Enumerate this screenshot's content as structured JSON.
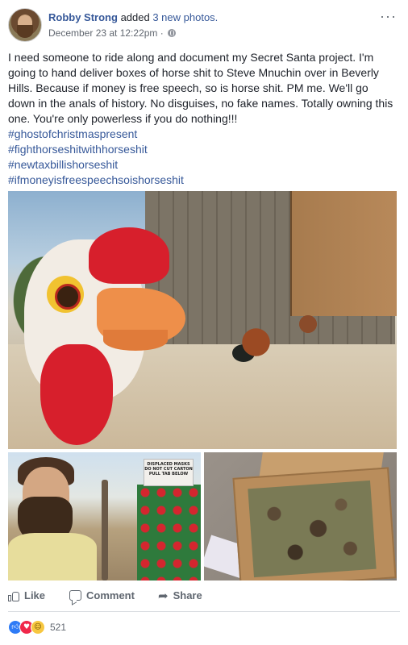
{
  "post": {
    "author": "Robby Strong",
    "action_prefix": "added",
    "action_link": "3 new photos.",
    "timestamp": "December 23 at 12:22pm",
    "separator": "·",
    "audience_icon": "globe-icon",
    "more_icon": "···",
    "body": "I need someone to ride along and document my Secret Santa project. I'm going to hand deliver boxes of horse shit to Steve Mnuchin over in Beverly Hills. Because if money is free speech, so is horse shit. PM me. We'll go down in the anals of history. No disguises, no fake names. Totally owning this one. You're only powerless if you do nothing!!!",
    "hashtags": [
      "#ghostofchristmaspresent",
      "#fighthorseshitwithhorseshit",
      "#newtaxbillishorseshit",
      "#ifmoneyisfreespeechsoishorseshit"
    ],
    "photo_label": {
      "line1": "DISPLACED MASKS",
      "line2": "DO NOT CUT CARTON",
      "line3": "PULL TAB BELOW"
    }
  },
  "actions": {
    "like_label": "Like",
    "comment_label": "Comment",
    "share_label": "Share"
  },
  "reactions": {
    "icons": [
      "like",
      "love",
      "haha"
    ],
    "count": "521"
  }
}
